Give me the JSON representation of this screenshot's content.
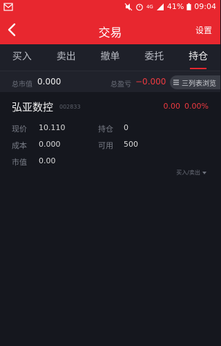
{
  "status_bar": {
    "battery": "41%",
    "time": "09:04",
    "network": "4G",
    "icons": [
      "notification-icon",
      "mute-icon",
      "alarm-icon",
      "signal-icon",
      "battery-icon"
    ]
  },
  "header": {
    "title": "交易",
    "settings_label": "设置",
    "back_icon": "chevron-left-icon"
  },
  "tabs": [
    {
      "label": "买入",
      "active": false
    },
    {
      "label": "卖出",
      "active": false
    },
    {
      "label": "撤单",
      "active": false
    },
    {
      "label": "委托",
      "active": false
    },
    {
      "label": "持仓",
      "active": true
    }
  ],
  "summary": {
    "total_value_label": "总市值",
    "total_value": "0.000",
    "total_pl_label": "总盈亏",
    "total_pl": "−0.000",
    "toggle_label": "三列表浏览"
  },
  "position": {
    "name": "弘亚数控",
    "code": "002833",
    "pl_value": "0.00",
    "pl_ratio": "0.00%",
    "fields": {
      "price_label": "现价",
      "price": "10.110",
      "holding_label": "持仓",
      "holding": "0",
      "cost_label": "成本",
      "cost": "0.000",
      "available_label": "可用",
      "available": "500",
      "market_value_label": "市值",
      "market_value": "0.00"
    },
    "action_label": "买入/卖出"
  },
  "colors": {
    "brand_red": "#e8272f",
    "loss_red": "#ef3a40",
    "background": "#15171e"
  }
}
